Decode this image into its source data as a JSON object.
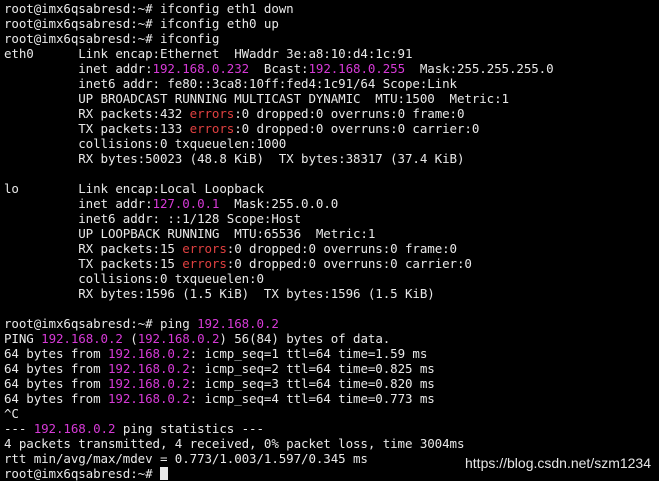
{
  "colors": {
    "background": "#000000",
    "text": "#e8e8e8",
    "accent": "#d63ad6",
    "error": "#e04040",
    "watermark": "#ffffff"
  },
  "terminal": {
    "lines": [
      [
        {
          "t": "root@imx6qsabresd:~# ifconfig eth1 down",
          "s": "normal"
        }
      ],
      [
        {
          "t": "root@imx6qsabresd:~# ifconfig eth0 up",
          "s": "normal"
        }
      ],
      [
        {
          "t": "root@imx6qsabresd:~# ifconfig",
          "s": "normal"
        }
      ],
      [
        {
          "t": "eth0      Link encap:Ethernet  HWaddr 3e:a8:10:d4:1c:91",
          "s": "normal"
        }
      ],
      [
        {
          "t": "          inet addr:",
          "s": "normal"
        },
        {
          "t": "192.168.0.232",
          "s": "accent"
        },
        {
          "t": "  Bcast:",
          "s": "normal"
        },
        {
          "t": "192.168.0.255",
          "s": "accent"
        },
        {
          "t": "  Mask:255.255.255.0",
          "s": "normal"
        }
      ],
      [
        {
          "t": "          inet6 addr: fe80::3ca8:10ff:fed4:1c91/64 Scope:Link",
          "s": "normal"
        }
      ],
      [
        {
          "t": "          UP BROADCAST RUNNING MULTICAST DYNAMIC  MTU:1500  Metric:1",
          "s": "normal"
        }
      ],
      [
        {
          "t": "          RX packets:432 ",
          "s": "normal"
        },
        {
          "t": "errors",
          "s": "error"
        },
        {
          "t": ":0 dropped:0 overruns:0 frame:0",
          "s": "normal"
        }
      ],
      [
        {
          "t": "          TX packets:133 ",
          "s": "normal"
        },
        {
          "t": "errors",
          "s": "error"
        },
        {
          "t": ":0 dropped:0 overruns:0 carrier:0",
          "s": "normal"
        }
      ],
      [
        {
          "t": "          collisions:0 txqueuelen:1000",
          "s": "normal"
        }
      ],
      [
        {
          "t": "          RX bytes:50023 (48.8 KiB)  TX bytes:38317 (37.4 KiB)",
          "s": "normal"
        }
      ],
      [
        {
          "t": "",
          "s": "normal"
        }
      ],
      [
        {
          "t": "lo        Link encap:Local Loopback",
          "s": "normal"
        }
      ],
      [
        {
          "t": "          inet addr:",
          "s": "normal"
        },
        {
          "t": "127.0.0.1",
          "s": "accent"
        },
        {
          "t": "  Mask:255.0.0.0",
          "s": "normal"
        }
      ],
      [
        {
          "t": "          inet6 addr: ::1/128 Scope:Host",
          "s": "normal"
        }
      ],
      [
        {
          "t": "          UP LOOPBACK RUNNING  MTU:65536  Metric:1",
          "s": "normal"
        }
      ],
      [
        {
          "t": "          RX packets:15 ",
          "s": "normal"
        },
        {
          "t": "errors",
          "s": "error"
        },
        {
          "t": ":0 dropped:0 overruns:0 frame:0",
          "s": "normal"
        }
      ],
      [
        {
          "t": "          TX packets:15 ",
          "s": "normal"
        },
        {
          "t": "errors",
          "s": "error"
        },
        {
          "t": ":0 dropped:0 overruns:0 carrier:0",
          "s": "normal"
        }
      ],
      [
        {
          "t": "          collisions:0 txqueuelen:0",
          "s": "normal"
        }
      ],
      [
        {
          "t": "          RX bytes:1596 (1.5 KiB)  TX bytes:1596 (1.5 KiB)",
          "s": "normal"
        }
      ],
      [
        {
          "t": "",
          "s": "normal"
        }
      ],
      [
        {
          "t": "root@imx6qsabresd:~# ping ",
          "s": "normal"
        },
        {
          "t": "192.168.0.2",
          "s": "accent"
        }
      ],
      [
        {
          "t": "PING ",
          "s": "normal"
        },
        {
          "t": "192.168.0.2",
          "s": "accent"
        },
        {
          "t": " (",
          "s": "normal"
        },
        {
          "t": "192.168.0.2",
          "s": "accent"
        },
        {
          "t": ") 56(84) bytes of data.",
          "s": "normal"
        }
      ],
      [
        {
          "t": "64 bytes from ",
          "s": "normal"
        },
        {
          "t": "192.168.0.2",
          "s": "accent"
        },
        {
          "t": ": icmp_seq=1 ttl=64 time=1.59 ms",
          "s": "normal"
        }
      ],
      [
        {
          "t": "64 bytes from ",
          "s": "normal"
        },
        {
          "t": "192.168.0.2",
          "s": "accent"
        },
        {
          "t": ": icmp_seq=2 ttl=64 time=0.825 ms",
          "s": "normal"
        }
      ],
      [
        {
          "t": "64 bytes from ",
          "s": "normal"
        },
        {
          "t": "192.168.0.2",
          "s": "accent"
        },
        {
          "t": ": icmp_seq=3 ttl=64 time=0.820 ms",
          "s": "normal"
        }
      ],
      [
        {
          "t": "64 bytes from ",
          "s": "normal"
        },
        {
          "t": "192.168.0.2",
          "s": "accent"
        },
        {
          "t": ": icmp_seq=4 ttl=64 time=0.773 ms",
          "s": "normal"
        }
      ],
      [
        {
          "t": "^C",
          "s": "normal"
        }
      ],
      [
        {
          "t": "--- ",
          "s": "normal"
        },
        {
          "t": "192.168.0.2",
          "s": "accent"
        },
        {
          "t": " ping statistics ---",
          "s": "normal"
        }
      ],
      [
        {
          "t": "4 packets transmitted, 4 received, 0% packet loss, time 3004ms",
          "s": "normal"
        }
      ],
      [
        {
          "t": "rtt min/avg/max/mdev = 0.773/1.003/1.597/0.345 ms",
          "s": "normal"
        }
      ],
      [
        {
          "t": "root@imx6qsabresd:~# ",
          "s": "normal"
        }
      ]
    ]
  },
  "watermark": {
    "text": "https://blog.csdn.net/szm1234"
  }
}
